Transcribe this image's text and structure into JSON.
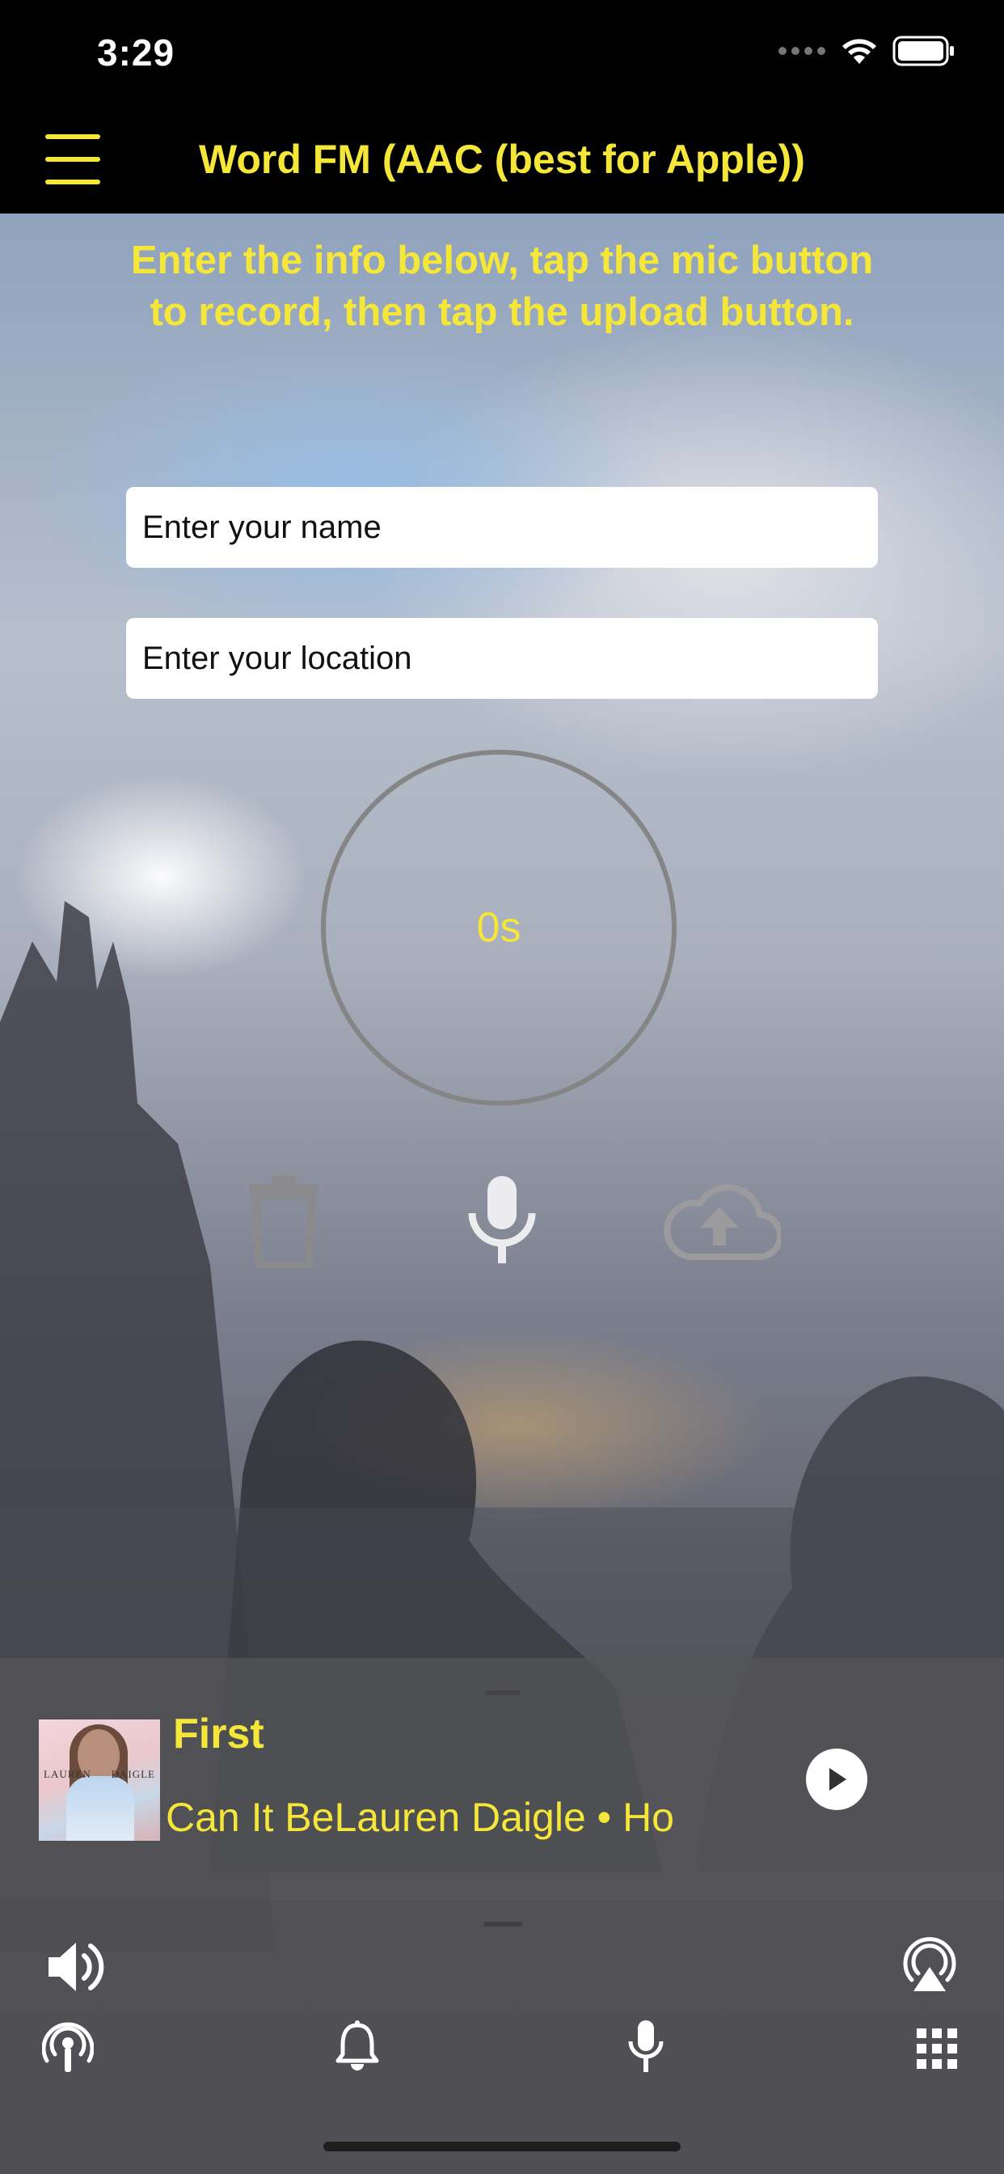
{
  "status_bar": {
    "time": "3:29"
  },
  "header": {
    "title": "Word FM (AAC (best for Apple))"
  },
  "instructions": "Enter the info below, tap the mic button to record, then tap the upload button.",
  "form": {
    "name_placeholder": "Enter your name",
    "location_placeholder": "Enter your location"
  },
  "recorder": {
    "timer": "0s",
    "controls": [
      "trash-icon",
      "microphone-icon",
      "cloud-upload-icon"
    ]
  },
  "now_playing": {
    "title": "First",
    "subtitle": "Can It BeLauren Daigle • Ho",
    "album_art_text": [
      "LAUREN",
      "DAIGLE"
    ]
  },
  "bottom_bar": {
    "row1": [
      "volume-icon",
      "airplay-icon"
    ],
    "row2": [
      "podcast-icon",
      "bell-icon",
      "microphone-icon",
      "grid-icon"
    ]
  },
  "colors": {
    "accent": "#f5e63a",
    "header_bg": "#000000"
  }
}
